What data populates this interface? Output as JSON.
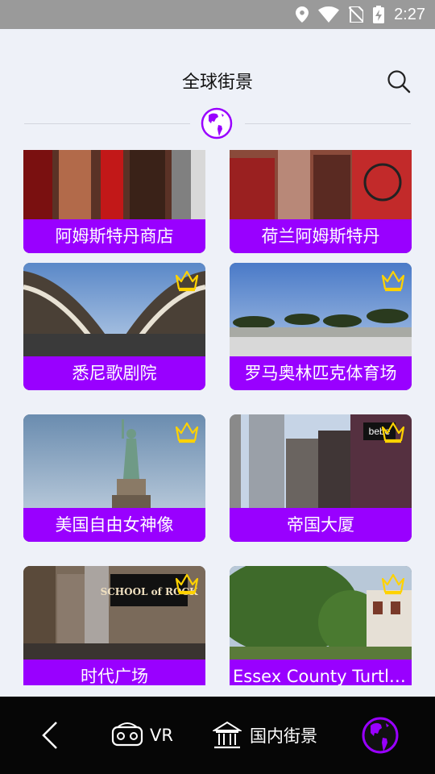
{
  "status_bar": {
    "time": "2:27",
    "icons": [
      "location-icon",
      "wifi-icon",
      "no-sim-icon",
      "battery-charging-icon"
    ]
  },
  "header": {
    "title": "全球街景",
    "search_icon": "search-icon",
    "badge_icon": "americas-globe-icon"
  },
  "colors": {
    "accent": "#9900ff",
    "crown": "#ffd200",
    "background": "#eef1f8",
    "bottom_bar": "#060606"
  },
  "cards": [
    {
      "label": "阿姆斯特丹商店",
      "premium": false
    },
    {
      "label": "荷兰阿姆斯特丹",
      "premium": false
    },
    {
      "label": "悉尼歌剧院",
      "premium": true
    },
    {
      "label": "罗马奥林匹克体育场",
      "premium": true
    },
    {
      "label": "美国自由女神像",
      "premium": true
    },
    {
      "label": "帝国大厦",
      "premium": true
    },
    {
      "label": "时代广场",
      "premium": true
    },
    {
      "label": "Essex County Turtle…",
      "premium": true
    }
  ],
  "thumb_text": {
    "school_of_rock_sign": "SCHOOL of ROCK",
    "bebe_sign": "bebe"
  },
  "bottom_nav": {
    "back_icon": "chevron-left-icon",
    "vr_label": "VR",
    "vr_icon": "vr-headset-icon",
    "domestic_label": "国内街景",
    "domestic_icon": "museum-icon",
    "global_icon": "americas-globe-icon"
  }
}
